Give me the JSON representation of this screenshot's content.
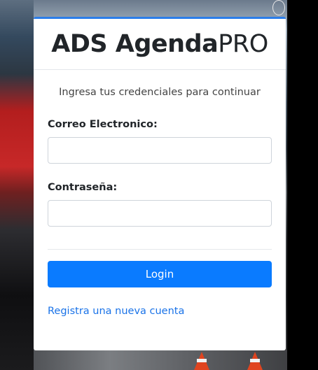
{
  "brand": {
    "bold": "ADS Agenda",
    "light": "PRO"
  },
  "login": {
    "subtitle": "Ingresa tus credenciales para continuar",
    "email_label": "Correo Electronico:",
    "email_value": "",
    "password_label": "Contraseña:",
    "password_value": "",
    "login_button": "Login",
    "register_link": "Registra una nueva cuenta"
  },
  "colors": {
    "accent": "#0a7bff",
    "link": "#1a73e8",
    "header_border": "#2b7de9"
  },
  "background": {
    "icons": [
      "cone-icon",
      "cone-icon"
    ]
  }
}
